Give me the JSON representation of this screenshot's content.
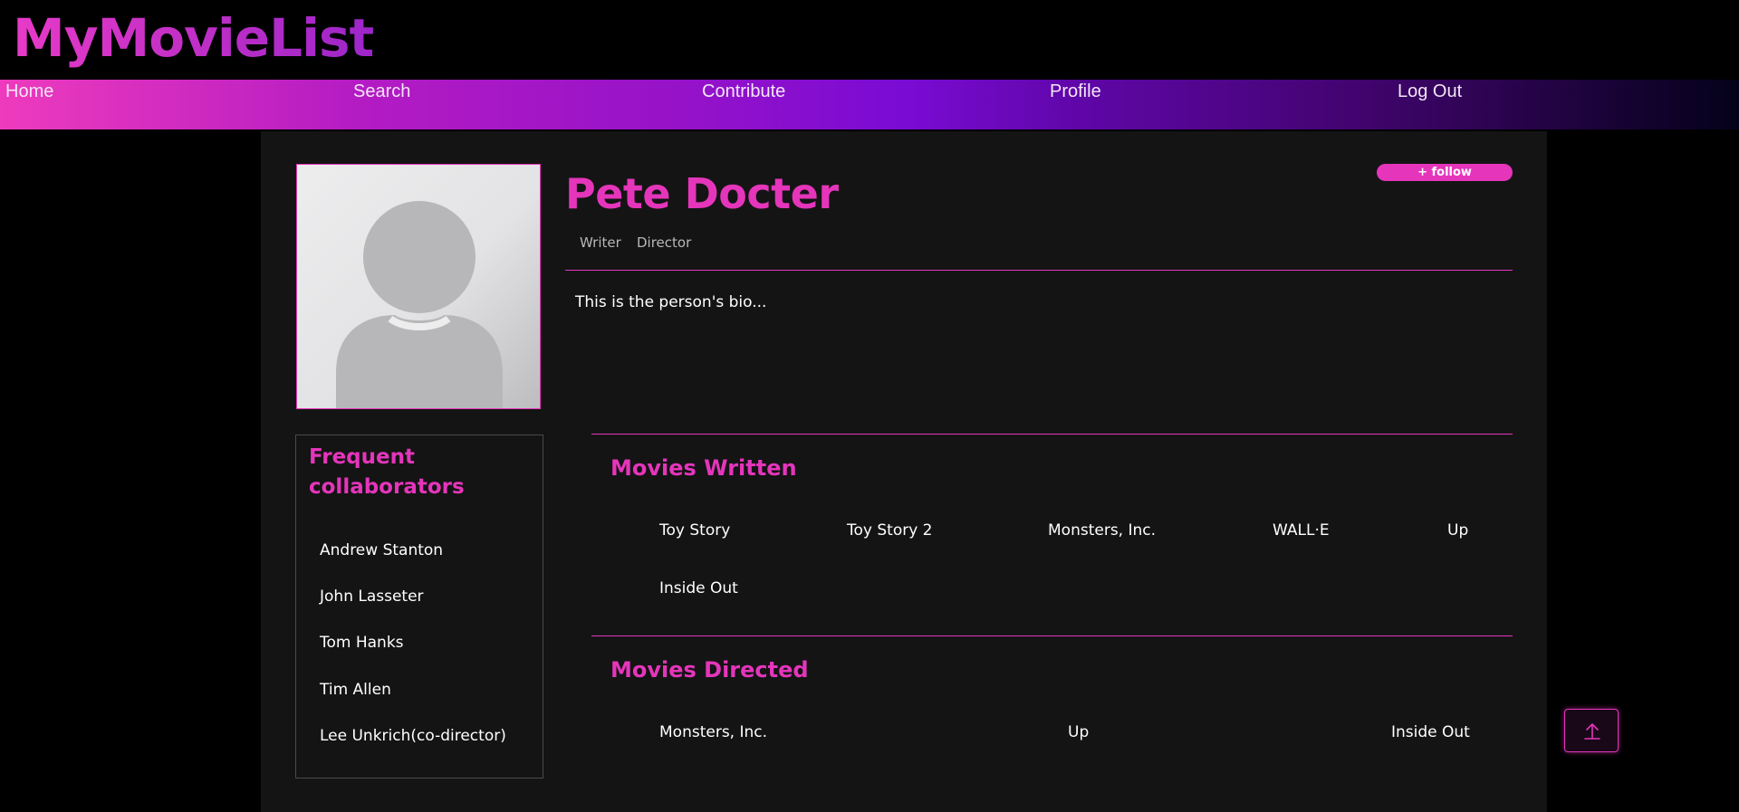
{
  "site": {
    "logo": "MyMovieList"
  },
  "nav": {
    "items": [
      {
        "label": "Home"
      },
      {
        "label": "Search"
      },
      {
        "label": "Contribute"
      },
      {
        "label": "Profile"
      },
      {
        "label": "Log Out"
      }
    ]
  },
  "person": {
    "name": "Pete Docter",
    "roles": [
      "Writer",
      "Director"
    ],
    "follow_label": "+ follow",
    "bio": "This is the person's bio..."
  },
  "collaborators": {
    "title": "Frequent collaborators",
    "items": [
      "Andrew Stanton",
      "John Lasseter",
      "Tom Hanks",
      "Tim Allen",
      "Lee Unkrich(co-director)"
    ]
  },
  "movies_written": {
    "title": "Movies Written",
    "items": [
      "Toy Story",
      "Toy Story 2",
      "Monsters, Inc.",
      "WALL·E",
      "Up",
      "Inside Out"
    ]
  },
  "movies_directed": {
    "title": "Movies Directed",
    "items": [
      "Monsters, Inc.",
      "Up",
      "Inside Out"
    ]
  },
  "colors": {
    "accent": "#e535bb",
    "panel": "#141414",
    "background": "#000000"
  },
  "icons": {
    "scroll_top": "arrow-up-icon",
    "avatar": "person-silhouette-icon"
  }
}
